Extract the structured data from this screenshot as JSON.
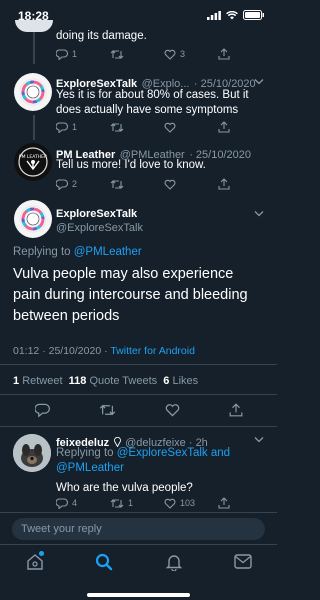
{
  "status_bar": {
    "time": "18:28"
  },
  "tweets": [
    {
      "body": "doing its damage.",
      "replies": "1",
      "retweets": "",
      "likes": "3"
    },
    {
      "name": "ExploreSexTalk",
      "handle": "@Explo...",
      "date": "· 25/10/2020",
      "body_line1": "Yes it is for about 80% of cases. But it",
      "body_line2": "does actually have some symptoms",
      "replies": "1",
      "retweets": "",
      "likes": ""
    },
    {
      "name": "PM Leather",
      "handle": "@PMLeather",
      "date": "· 25/10/2020",
      "body": "Tell us more! I'd love to know.",
      "replies": "2",
      "retweets": "",
      "likes": ""
    }
  ],
  "main_tweet": {
    "name": "ExploreSexTalk",
    "handle": "@ExploreSexTalk",
    "replying_prefix": "Replying to",
    "replying_to": "@PMLeather",
    "body_line1": "Vulva people may also experience",
    "body_line2": "pain during intercourse and bleeding",
    "body_line3": "between periods",
    "time": "01:12 · 25/10/2020 ·",
    "client": "Twitter for Android",
    "retweets_count": "1",
    "retweets_label": "Retweet",
    "quotes_count": "118",
    "quotes_label": "Quote Tweets",
    "likes_count": "6",
    "likes_label": "Likes"
  },
  "reply": {
    "name": "feixedeluz",
    "handle": "@deluzfeixe · 2h",
    "replying_prefix": "Replying to",
    "replying_to_1": "@ExploreSexTalk and",
    "replying_to_2": "@PMLeather",
    "body": "Who are the vulva people?",
    "replies": "4",
    "retweets": "1",
    "likes": "103"
  },
  "composer": {
    "placeholder": "Tweet your reply"
  },
  "colors": {
    "background": "#15202b",
    "accent": "#1da1f2",
    "muted": "#8899a6",
    "divider": "#38444d"
  }
}
